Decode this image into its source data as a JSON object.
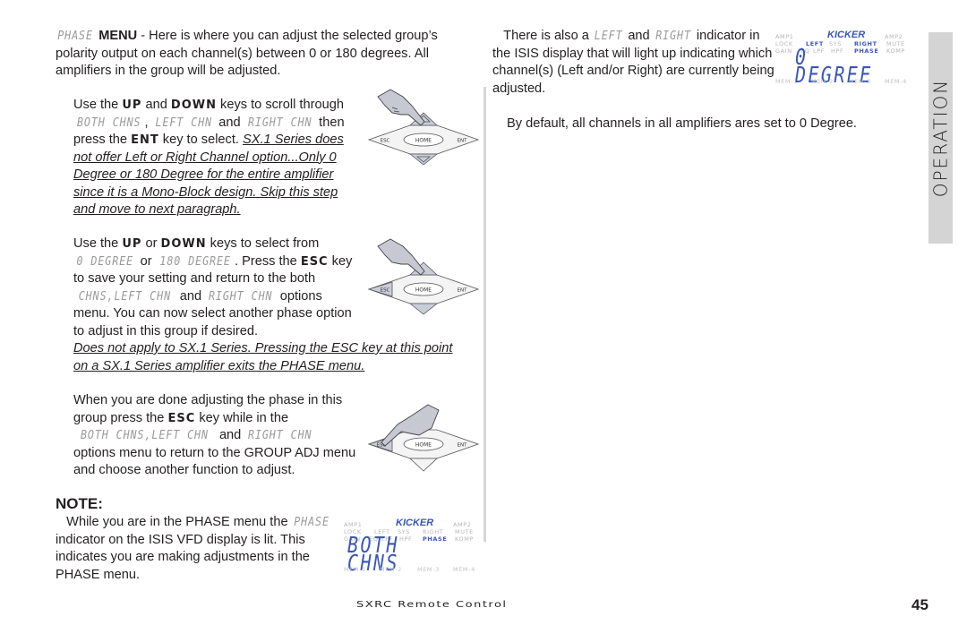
{
  "left_column": {
    "phase_intro": {
      "lcd": "PHASE",
      "bold": "MENU",
      "text": " - Here is where you can adjust the selected group’s polarity output on each channel(s) between 0 or 180 degrees. All amplifiers in the group will be adjusted."
    },
    "step1": {
      "t1": "Use the ",
      "k_up": "UP",
      "t2": " and ",
      "k_down": "DOWN",
      "t3": " keys to scroll through ",
      "lcd_both": "BOTH CHNS",
      "t4": ", ",
      "lcd_left": "LEFT CHN",
      "t5": " and ",
      "lcd_right": "RIGHT CHN",
      "t6": " then press the ",
      "k_ent": "ENT",
      "t7": " key to select. ",
      "note": "SX.1 Series does not offer Left or Right Channel option...Only 0 Degree or 180 Degree for the entire amplifier since it is a Mono-Block design. Skip this step and move to next paragraph."
    },
    "step2": {
      "t1": "Use the ",
      "k_up": "UP",
      "t2": " or ",
      "k_down": "DOWN",
      "t3": " keys to select from ",
      "lcd_0": "0 DEGREE",
      "t4": " or ",
      "lcd_180": "180 DEGREE",
      "t5": ". Press the ",
      "k_esc": "ESC",
      "t6": " key to save your setting and return to the both ",
      "lcd_chns": "CHNS,LEFT CHN",
      "t7": " and ",
      "lcd_right": "RIGHT CHN",
      "t8": " options menu. You can now select another phase option to adjust in this group if desired.",
      "note": "Does not apply to SX.1 Series. Pressing the ESC key at this point on a SX.1 Series amplifier exits the PHASE menu."
    },
    "step3": {
      "t1": "When you are done adjusting the phase in this group press the ",
      "k_esc": "ESC",
      "t2": " key while in the ",
      "lcd_both": "BOTH CHNS,LEFT CHN",
      "t3": " and ",
      "lcd_right": "RIGHT CHN",
      "t4": " options menu to return to the GROUP ADJ menu and choose another function to adjust."
    },
    "note_heading": "NOTE:",
    "note_body": {
      "t1": "While you are in the PHASE menu the ",
      "lcd": "PHASE",
      "t2": " indicator on the ISIS VFD display is lit. This indicates you are making adjustments in the PHASE menu."
    }
  },
  "right_column": {
    "indicator": {
      "t1": "There is also a ",
      "lcd_left": "LEFT",
      "t2": " and ",
      "lcd_right": "RIGHT",
      "t3": " indicator in the ISIS display that will light up indicating which channel(s) (Left and/or Right) are currently being adjusted."
    },
    "default_text": "By default, all channels in all amplifiers ares set to 0 Degree."
  },
  "keypad": {
    "esc": "ESC",
    "home": "HOME",
    "ent": "ENT"
  },
  "vfd_top": {
    "logo": "KICKER",
    "row1": [
      "AMP1",
      "AMP2"
    ],
    "row2": [
      "LOCK",
      "LEFT",
      "SYS",
      "RIGHT",
      "MUTE"
    ],
    "row3": [
      "GAIN",
      "EQ",
      "LPF",
      "HPF",
      "PHASE",
      "KOMP"
    ],
    "main": "0 DEGREE",
    "mem": [
      "MEM-1",
      "MEM-2",
      "MEM-3",
      "MEM-4"
    ],
    "lit": [
      "LEFT",
      "RIGHT",
      "PHASE"
    ]
  },
  "vfd_bottom": {
    "logo": "KICKER",
    "row1": [
      "AMP1",
      "AMP2"
    ],
    "row2": [
      "LOCK",
      "LEFT",
      "SYS",
      "RIGHT",
      "MUTE"
    ],
    "row3": [
      "GAIN",
      "EQ",
      "LPF",
      "HPF",
      "PHASE",
      "KOMP"
    ],
    "main": "BOTH CHNS",
    "mem": [
      "MEM-1",
      "MEM-2",
      "MEM-3",
      "MEM-4"
    ],
    "lit": [
      "PHASE"
    ]
  },
  "side_tab": "OPERATION",
  "footer": {
    "title": "SXRC Remote Control",
    "page": "45"
  },
  "colors": {
    "vfd_blue": "#3a56b8",
    "tab_gray": "#d4d4d4",
    "text": "#231f20"
  }
}
